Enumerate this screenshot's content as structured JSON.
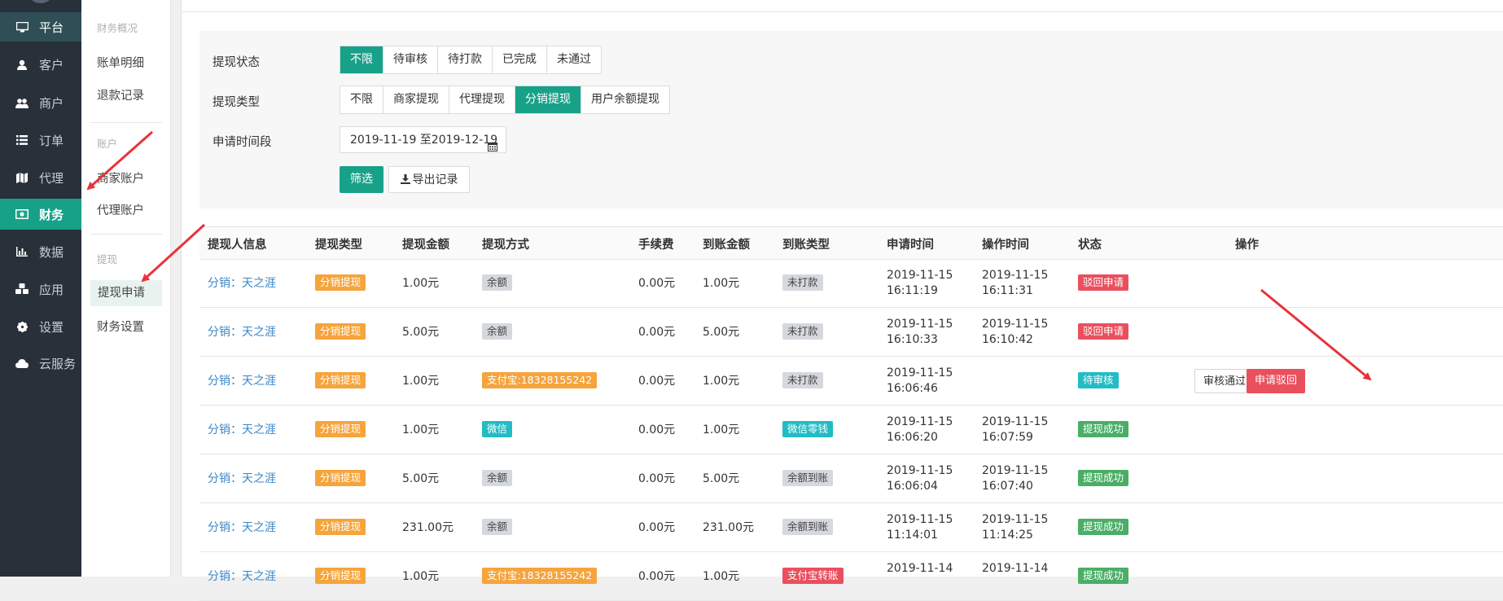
{
  "sidebar": {
    "items": [
      {
        "label": "平台",
        "icon": "monitor-icon"
      },
      {
        "label": "客户",
        "icon": "user-icon"
      },
      {
        "label": "商户",
        "icon": "users-icon"
      },
      {
        "label": "订单",
        "icon": "list-icon"
      },
      {
        "label": "代理",
        "icon": "map-icon"
      },
      {
        "label": "财务",
        "icon": "money-icon"
      },
      {
        "label": "数据",
        "icon": "bar-chart-icon"
      },
      {
        "label": "应用",
        "icon": "cubes-icon"
      },
      {
        "label": "设置",
        "icon": "gear-icon"
      },
      {
        "label": "云服务",
        "icon": "cloud-icon"
      }
    ]
  },
  "submenu": {
    "group1_title": "财务概况",
    "item_bill": "账单明细",
    "item_refund": "退款记录",
    "group2_title": "账户",
    "item_merchant_account": "商家账户",
    "item_agent_account": "代理账户",
    "group3_title": "提现",
    "item_withdraw_apply": "提现申请",
    "item_finance_settings": "财务设置"
  },
  "filters": {
    "status_label": "提现状态",
    "status_options": [
      "不限",
      "待审核",
      "待打款",
      "已完成",
      "未通过"
    ],
    "type_label": "提现类型",
    "type_options": [
      "不限",
      "商家提现",
      "代理提现",
      "分销提现",
      "用户余额提现"
    ],
    "date_label": "申请时间段",
    "date_value": "2019-11-19 至2019-12-19",
    "filter_button": "筛选",
    "export_button": "导出记录"
  },
  "table": {
    "headers": [
      "提现人信息",
      "提现类型",
      "提现金额",
      "提现方式",
      "手续费",
      "到账金额",
      "到账类型",
      "申请时间",
      "操作时间",
      "状态",
      "操作"
    ],
    "rows": [
      {
        "person": "分销：天之涯",
        "type": "分销提现",
        "amount": "1.00元",
        "method": "余额",
        "fee": "0.00元",
        "received": "1.00元",
        "recv_type": "未打款",
        "apply_date": "2019-11-15",
        "apply_time": "16:11:19",
        "op_date": "2019-11-15",
        "op_time": "16:11:31",
        "status": "驳回申请"
      },
      {
        "person": "分销：天之涯",
        "type": "分销提现",
        "amount": "5.00元",
        "method": "余额",
        "fee": "0.00元",
        "received": "5.00元",
        "recv_type": "未打款",
        "apply_date": "2019-11-15",
        "apply_time": "16:10:33",
        "op_date": "2019-11-15",
        "op_time": "16:10:42",
        "status": "驳回申请"
      },
      {
        "person": "分销：天之涯",
        "type": "分销提现",
        "amount": "1.00元",
        "method": "支付宝:18328155242",
        "fee": "0.00元",
        "received": "1.00元",
        "recv_type": "未打款",
        "apply_date": "2019-11-15",
        "apply_time": "16:06:46",
        "op_date": "",
        "op_time": "",
        "status": "待审核",
        "action_approve": "审核通过",
        "action_reject": "申请驳回"
      },
      {
        "person": "分销：天之涯",
        "type": "分销提现",
        "amount": "1.00元",
        "method": "微信",
        "fee": "0.00元",
        "received": "1.00元",
        "recv_type": "微信零钱",
        "apply_date": "2019-11-15",
        "apply_time": "16:06:20",
        "op_date": "2019-11-15",
        "op_time": "16:07:59",
        "status": "提现成功"
      },
      {
        "person": "分销：天之涯",
        "type": "分销提现",
        "amount": "5.00元",
        "method": "余额",
        "fee": "0.00元",
        "received": "5.00元",
        "recv_type": "余额到账",
        "apply_date": "2019-11-15",
        "apply_time": "16:06:04",
        "op_date": "2019-11-15",
        "op_time": "16:07:40",
        "status": "提现成功"
      },
      {
        "person": "分销：天之涯",
        "type": "分销提现",
        "amount": "231.00元",
        "method": "余额",
        "fee": "0.00元",
        "received": "231.00元",
        "recv_type": "余额到账",
        "apply_date": "2019-11-15",
        "apply_time": "11:14:01",
        "op_date": "2019-11-15",
        "op_time": "11:14:25",
        "status": "提现成功"
      },
      {
        "person": "分销：天之涯",
        "type": "分销提现",
        "amount": "1.00元",
        "method": "支付宝:18328155242",
        "fee": "0.00元",
        "received": "1.00元",
        "recv_type": "支付宝转账",
        "apply_date": "2019-11-14",
        "apply_time": "",
        "op_date": "2019-11-14",
        "op_time": "",
        "status": "提现成功"
      }
    ]
  },
  "colors": {
    "accent": "#18a189",
    "orange": "#f6a43c",
    "red": "#ea4f5e",
    "teal": "#21bcc4",
    "green": "#4aae66",
    "sidebar": "#28303a"
  }
}
